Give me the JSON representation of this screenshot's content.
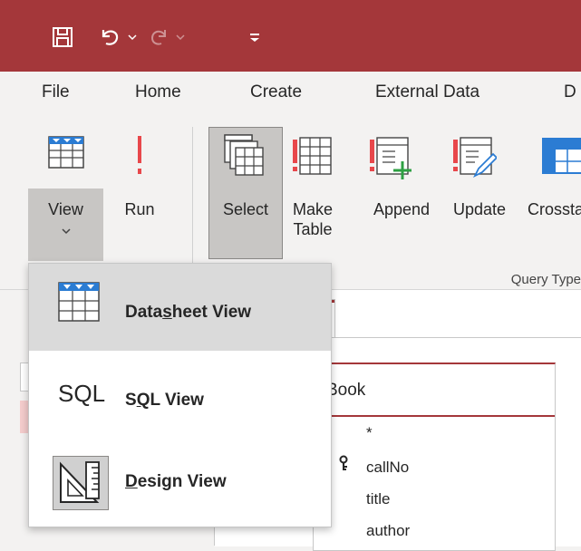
{
  "quick_access": {
    "save_icon": "save-icon",
    "undo_icon": "undo-icon",
    "redo_icon": "redo-icon",
    "customize_icon": "customize-qat-icon"
  },
  "ribbon_tabs": [
    "File",
    "Home",
    "Create",
    "External Data",
    "D"
  ],
  "ribbon_buttons": {
    "view": "View",
    "run": "Run",
    "select": "Select",
    "make_table": "Make\nTable",
    "append": "Append",
    "update": "Update",
    "crosstab": "Crossta"
  },
  "group_label": "Query Type",
  "document_tab": {
    "close_glyph": "×"
  },
  "table_box": {
    "title": "Book",
    "fields": [
      "*",
      "callNo",
      "title",
      "author"
    ]
  },
  "view_menu": {
    "items": [
      {
        "pre": "Data",
        "u": "s",
        "post": "heet View"
      },
      {
        "icon_text": "SQL",
        "pre": "S",
        "u": "Q",
        "post": "L View"
      },
      {
        "pre": "",
        "u": "D",
        "post": "esign View"
      }
    ]
  },
  "colors": {
    "accent": "#a4373a",
    "menu_selected": "#dadada"
  }
}
